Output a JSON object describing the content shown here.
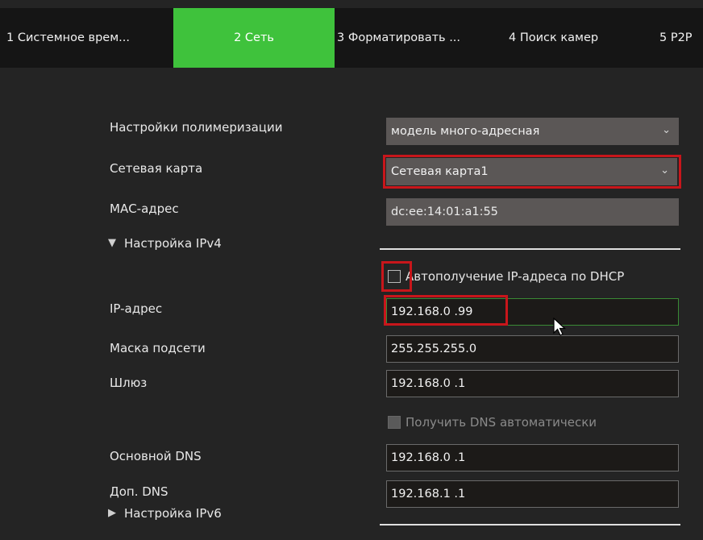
{
  "tabs": [
    {
      "label": "1 Системное врем...",
      "active": false
    },
    {
      "label": "2 Сеть",
      "active": true
    },
    {
      "label": "3 Форматировать ...",
      "active": false
    },
    {
      "label": "4 Поиск камер",
      "active": false
    },
    {
      "label": "5 P2P",
      "active": false
    }
  ],
  "colors": {
    "active_tab": "#3fc23c",
    "highlight": "#c8161b",
    "background": "#242424"
  },
  "form": {
    "aggregation_label": "Настройки полимеризации",
    "aggregation_value": "модель много-адресная",
    "nic_label": "Сетевая карта",
    "nic_value": "Сетевая карта1",
    "mac_label": "МАС-адрес",
    "mac_value": "dc:ee:14:01:a1:55",
    "ipv4_section": "Настройка IPv4",
    "dhcp_label": "Автополучение IP-адреса по DHCP",
    "dhcp_checked": false,
    "ip_label": "IP-адрес",
    "ip_value": "192.168.0  .99",
    "mask_label": "Маска подсети",
    "mask_value": "255.255.255.0",
    "gateway_label": "Шлюз",
    "gateway_value": "192.168.0  .1",
    "dns_auto_label": "Получить DNS автоматически",
    "dns_auto_checked": false,
    "dns1_label": "Основной DNS",
    "dns1_value": "192.168.0  .1",
    "dns2_label": "Доп. DNS",
    "dns2_value": "192.168.1  .1",
    "ipv6_section": "Настройка IPv6"
  },
  "icons": {
    "dropdown": "chevron-down-icon",
    "expanded": "triangle-down-icon",
    "collapsed": "triangle-right-icon",
    "pointer": "mouse-cursor-icon"
  }
}
